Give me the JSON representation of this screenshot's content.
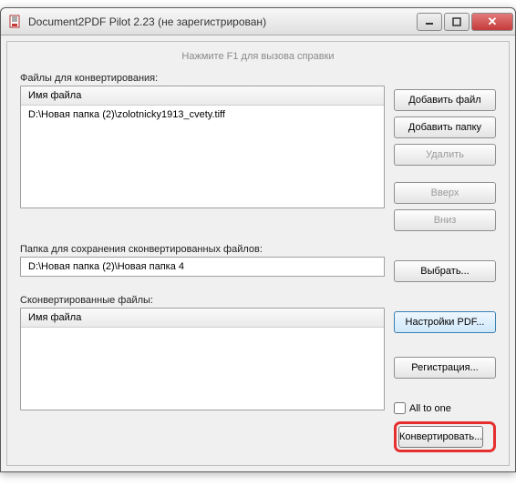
{
  "window": {
    "title": "Document2PDF Pilot 2.23  (не зарегистрирован)"
  },
  "hint": "Нажмите F1 для вызова справки",
  "files_section": {
    "label": "Файлы для конвертирования:",
    "column_header": "Имя файла",
    "rows": [
      "D:\\Новая папка (2)\\zolotnicky1913_cvety.tiff"
    ]
  },
  "output_section": {
    "label": "Папка для сохранения сконвертированных файлов:",
    "path": "D:\\Новая папка (2)\\Новая папка 4"
  },
  "converted_section": {
    "label": "Сконвертированные файлы:",
    "column_header": "Имя файла",
    "rows": []
  },
  "buttons": {
    "add_file": "Добавить файл",
    "add_folder": "Добавить папку",
    "delete": "Удалить",
    "up": "Вверх",
    "down": "Вниз",
    "choose": "Выбрать...",
    "pdf_settings": "Настройки PDF...",
    "register": "Регистрация...",
    "convert": "Конвертировать..."
  },
  "checkbox": {
    "all_to_one": "All to one",
    "checked": false
  },
  "icons": {
    "close": "✕"
  }
}
